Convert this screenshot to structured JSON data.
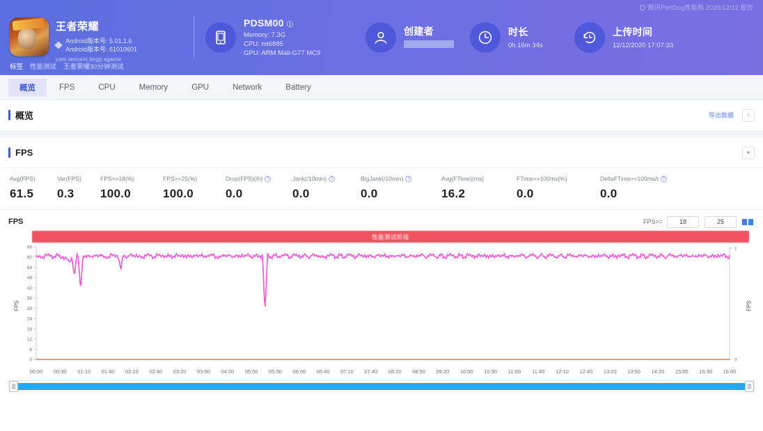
{
  "header": {
    "watermark": "腾讯PerfDog性能狗 2020/12/12 报告",
    "app": {
      "title": "王者荣耀",
      "line1": "Android版本号: 5.01.1.6",
      "line2": "Android版本号: 61010601",
      "package": "com.tencent.tmgp.sgame"
    },
    "device": {
      "name": "PDSM00",
      "memory": "Memory: 7.3G",
      "cpu": "CPU: mt6885",
      "gpu": "GPU: ARM Mali-G77 MC9"
    },
    "creator": {
      "title": "创建者",
      "value": ""
    },
    "duration": {
      "title": "时长",
      "value": "0h 16m 34s"
    },
    "upload": {
      "title": "上传时间",
      "value": "12/12/2020 17:07:33"
    },
    "tags": {
      "label": "标签",
      "items": [
        "性能测试",
        "王者荣耀30分钟测试"
      ]
    }
  },
  "tabs": [
    {
      "label": "概览",
      "active": true
    },
    {
      "label": "FPS",
      "active": false
    },
    {
      "label": "CPU",
      "active": false
    },
    {
      "label": "Memory",
      "active": false
    },
    {
      "label": "GPU",
      "active": false
    },
    {
      "label": "Network",
      "active": false
    },
    {
      "label": "Battery",
      "active": false
    }
  ],
  "overview_section": {
    "title": "概览",
    "export_label": "导出数据",
    "collapse_icon": "chevron"
  },
  "fps_section": {
    "title": "FPS",
    "collapse_icon": "chevron"
  },
  "metrics": [
    {
      "label": "Avg(FPS)",
      "value": "61.5",
      "help": false
    },
    {
      "label": "Var(FPS)",
      "value": "0.3",
      "help": false
    },
    {
      "label": "FPS>=18(%)",
      "value": "100.0",
      "help": false
    },
    {
      "label": "FPS>=25(%)",
      "value": "100.0",
      "help": false
    },
    {
      "label": "Drop(FPS)(/h)",
      "value": "0.0",
      "help": true
    },
    {
      "label": "Jank(/10min)",
      "value": "0.0",
      "help": true
    },
    {
      "label": "BigJank(/10min)",
      "value": "0.0",
      "help": true
    },
    {
      "label": "Avg(FTime)(ms)",
      "value": "16.2",
      "help": false
    },
    {
      "label": "FTime>=100ms(%)",
      "value": "0.0",
      "help": false
    },
    {
      "label": "DeltaFTime>=100ms/t",
      "value": "0.0",
      "help": true
    }
  ],
  "chart_controls": {
    "chart_name": "FPS",
    "threshold_label": "FPS>=",
    "threshold_1": "18",
    "threshold_2": "25",
    "banner_text": "性能测试阶段"
  },
  "chart_data": {
    "type": "line",
    "title": "FPS",
    "xlabel": "",
    "ylabel": "FPS",
    "ylabel_right": "FPS",
    "ylim": [
      0,
      66
    ],
    "ylim_right": [
      0,
      1
    ],
    "ytick_labels": [
      "66",
      "60",
      "54",
      "48",
      "42",
      "36",
      "30",
      "24",
      "18",
      "12",
      "6",
      "0"
    ],
    "ytick_values": [
      66,
      60,
      54,
      48,
      42,
      36,
      30,
      24,
      18,
      12,
      6,
      0
    ],
    "ytick_labels_right": [
      "1",
      "0"
    ],
    "xtick_labels": [
      "00:00",
      "00:30",
      "01:10",
      "01:40",
      "02:10",
      "02:40",
      "03:20",
      "03:50",
      "04:20",
      "05:00",
      "05:30",
      "06:00",
      "06:40",
      "07:10",
      "07:40",
      "08:20",
      "08:50",
      "09:20",
      "10:00",
      "10:30",
      "11:00",
      "11:40",
      "12:10",
      "12:40",
      "13:20",
      "13:50",
      "14:20",
      "15:00",
      "15:30",
      "16:00"
    ],
    "grid": false,
    "legend_position": "none",
    "series": [
      {
        "name": "FPS",
        "color": "#e021c8",
        "values": [
          60,
          60,
          61,
          61,
          60,
          61,
          60,
          59,
          58,
          60,
          61,
          61,
          60,
          61,
          60,
          61,
          61,
          60,
          60,
          61,
          61,
          60,
          61,
          60,
          61,
          61,
          60,
          60,
          61,
          61,
          60,
          61,
          61,
          60,
          61,
          60,
          61,
          61,
          60,
          61,
          60,
          61,
          61,
          60,
          61,
          61,
          60,
          60,
          61,
          61,
          60,
          61,
          60,
          61,
          61,
          60,
          61,
          60,
          61,
          61,
          60,
          61,
          60,
          61,
          61,
          60,
          61,
          61,
          60,
          61,
          60,
          61,
          61,
          60,
          60,
          61,
          61,
          60,
          61,
          60,
          61,
          61,
          60,
          61,
          61,
          60,
          61,
          60,
          61,
          61,
          60,
          61,
          60,
          61,
          61,
          60,
          61,
          60,
          61,
          61,
          60,
          61,
          61,
          60,
          61,
          60,
          61,
          61,
          60,
          61,
          60,
          61,
          61,
          60,
          61,
          61,
          60,
          61,
          60,
          61,
          61,
          60,
          61,
          60,
          61,
          61,
          60,
          61,
          61,
          60,
          61,
          60,
          61,
          61,
          60,
          61,
          60,
          61,
          61,
          60,
          61,
          61,
          60,
          61,
          60,
          61,
          61,
          60,
          61,
          60,
          61,
          61,
          60,
          61,
          61,
          60,
          61,
          60,
          61,
          61,
          60,
          61,
          60,
          61,
          61,
          60,
          61,
          61,
          60,
          61,
          60,
          61,
          61,
          60,
          61,
          60,
          61,
          61,
          60,
          61
        ]
      }
    ],
    "dropouts": [
      {
        "x_pct": 5.5,
        "depth": 12
      },
      {
        "x_pct": 6.4,
        "depth": 20
      },
      {
        "x_pct": 33.0,
        "depth": 34
      },
      {
        "x_pct": 12.2,
        "depth": 8
      }
    ],
    "avg_fps": 61.5
  },
  "range_slider": {
    "start_pct": 0,
    "end_pct": 100
  }
}
